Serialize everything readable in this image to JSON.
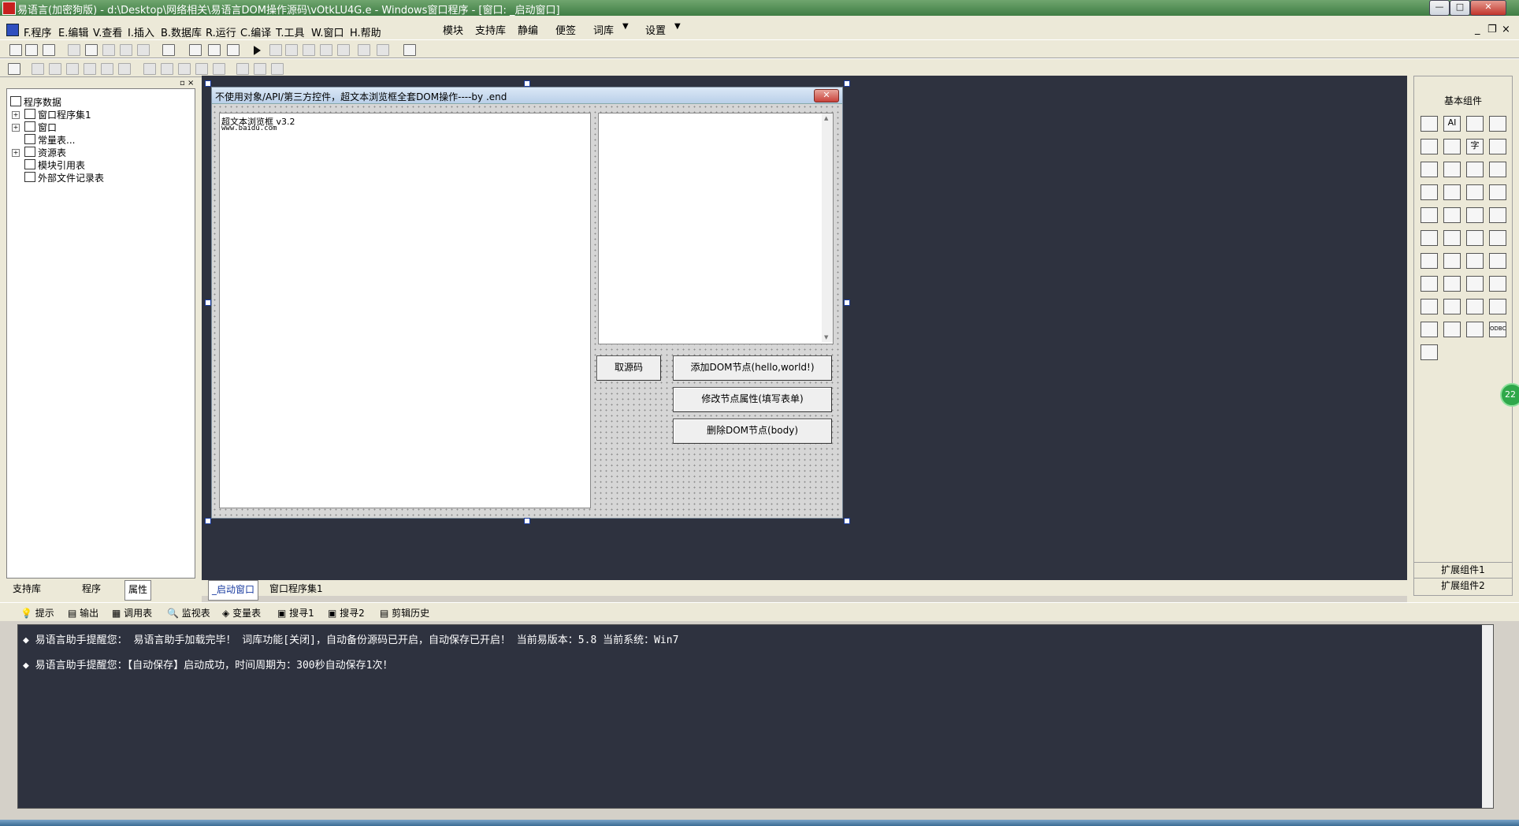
{
  "window": {
    "title": "易语言(加密狗版) - d:\\Desktop\\网络相关\\易语言DOM操作源码\\vOtkLU4G.e - Windows窗口程序 - [窗口: _启动窗口]",
    "min": "—",
    "max": "□",
    "close": "✕"
  },
  "menubar": {
    "items": [
      "F.程序",
      "E.编辑",
      "V.查看",
      "I.插入",
      "B.数据库",
      "R.运行",
      "C.编译",
      "T.工具",
      "W.窗口",
      "H.帮助"
    ],
    "right_items": [
      "模块",
      "支持库",
      "静编",
      "便签",
      "词库",
      "设置"
    ],
    "mdi_min": "_",
    "mdi_restore": "❐",
    "mdi_close": "×"
  },
  "left_panel": {
    "tree": [
      "程序数据",
      "窗口程序集1",
      "窗口",
      "常量表...",
      "资源表",
      "模块引用表",
      "外部文件记录表"
    ],
    "tabs": [
      "支持库",
      "程序",
      "属性"
    ]
  },
  "form": {
    "title": "不使用对象/API/第三方控件，超文本浏览框全套DOM操作----by .end",
    "close": "✕",
    "browser_line1": "超文本浏览框 v3.2",
    "browser_line2": "www.baidu.com",
    "buttons": [
      "取源码",
      "添加DOM节点(hello,world!)",
      "修改节点属性(填写表单)",
      "删除DOM节点(body)"
    ]
  },
  "toolbox": {
    "title": "基本组件",
    "ext1": "扩展组件1",
    "ext2": "扩展组件2",
    "text_icons": [
      "AI",
      "字",
      "ODBC",
      "ODBC"
    ]
  },
  "design_tabs": [
    "_启动窗口",
    "窗口程序集1"
  ],
  "output_tabs": [
    "提示",
    "输出",
    "调用表",
    "监视表",
    "变量表",
    "搜寻1",
    "搜寻2",
    "剪辑历史"
  ],
  "output_lines": [
    "易语言助手提醒您： 易语言助手加载完毕！ 词库功能[关闭]，自动备份源码已开启，自动保存已开启！ 当前易版本：5.8  当前系统：Win7",
    "易语言助手提醒您：【自动保存】启动成功，时间周期为：300秒自动保存1次！"
  ],
  "side_badge": "22"
}
